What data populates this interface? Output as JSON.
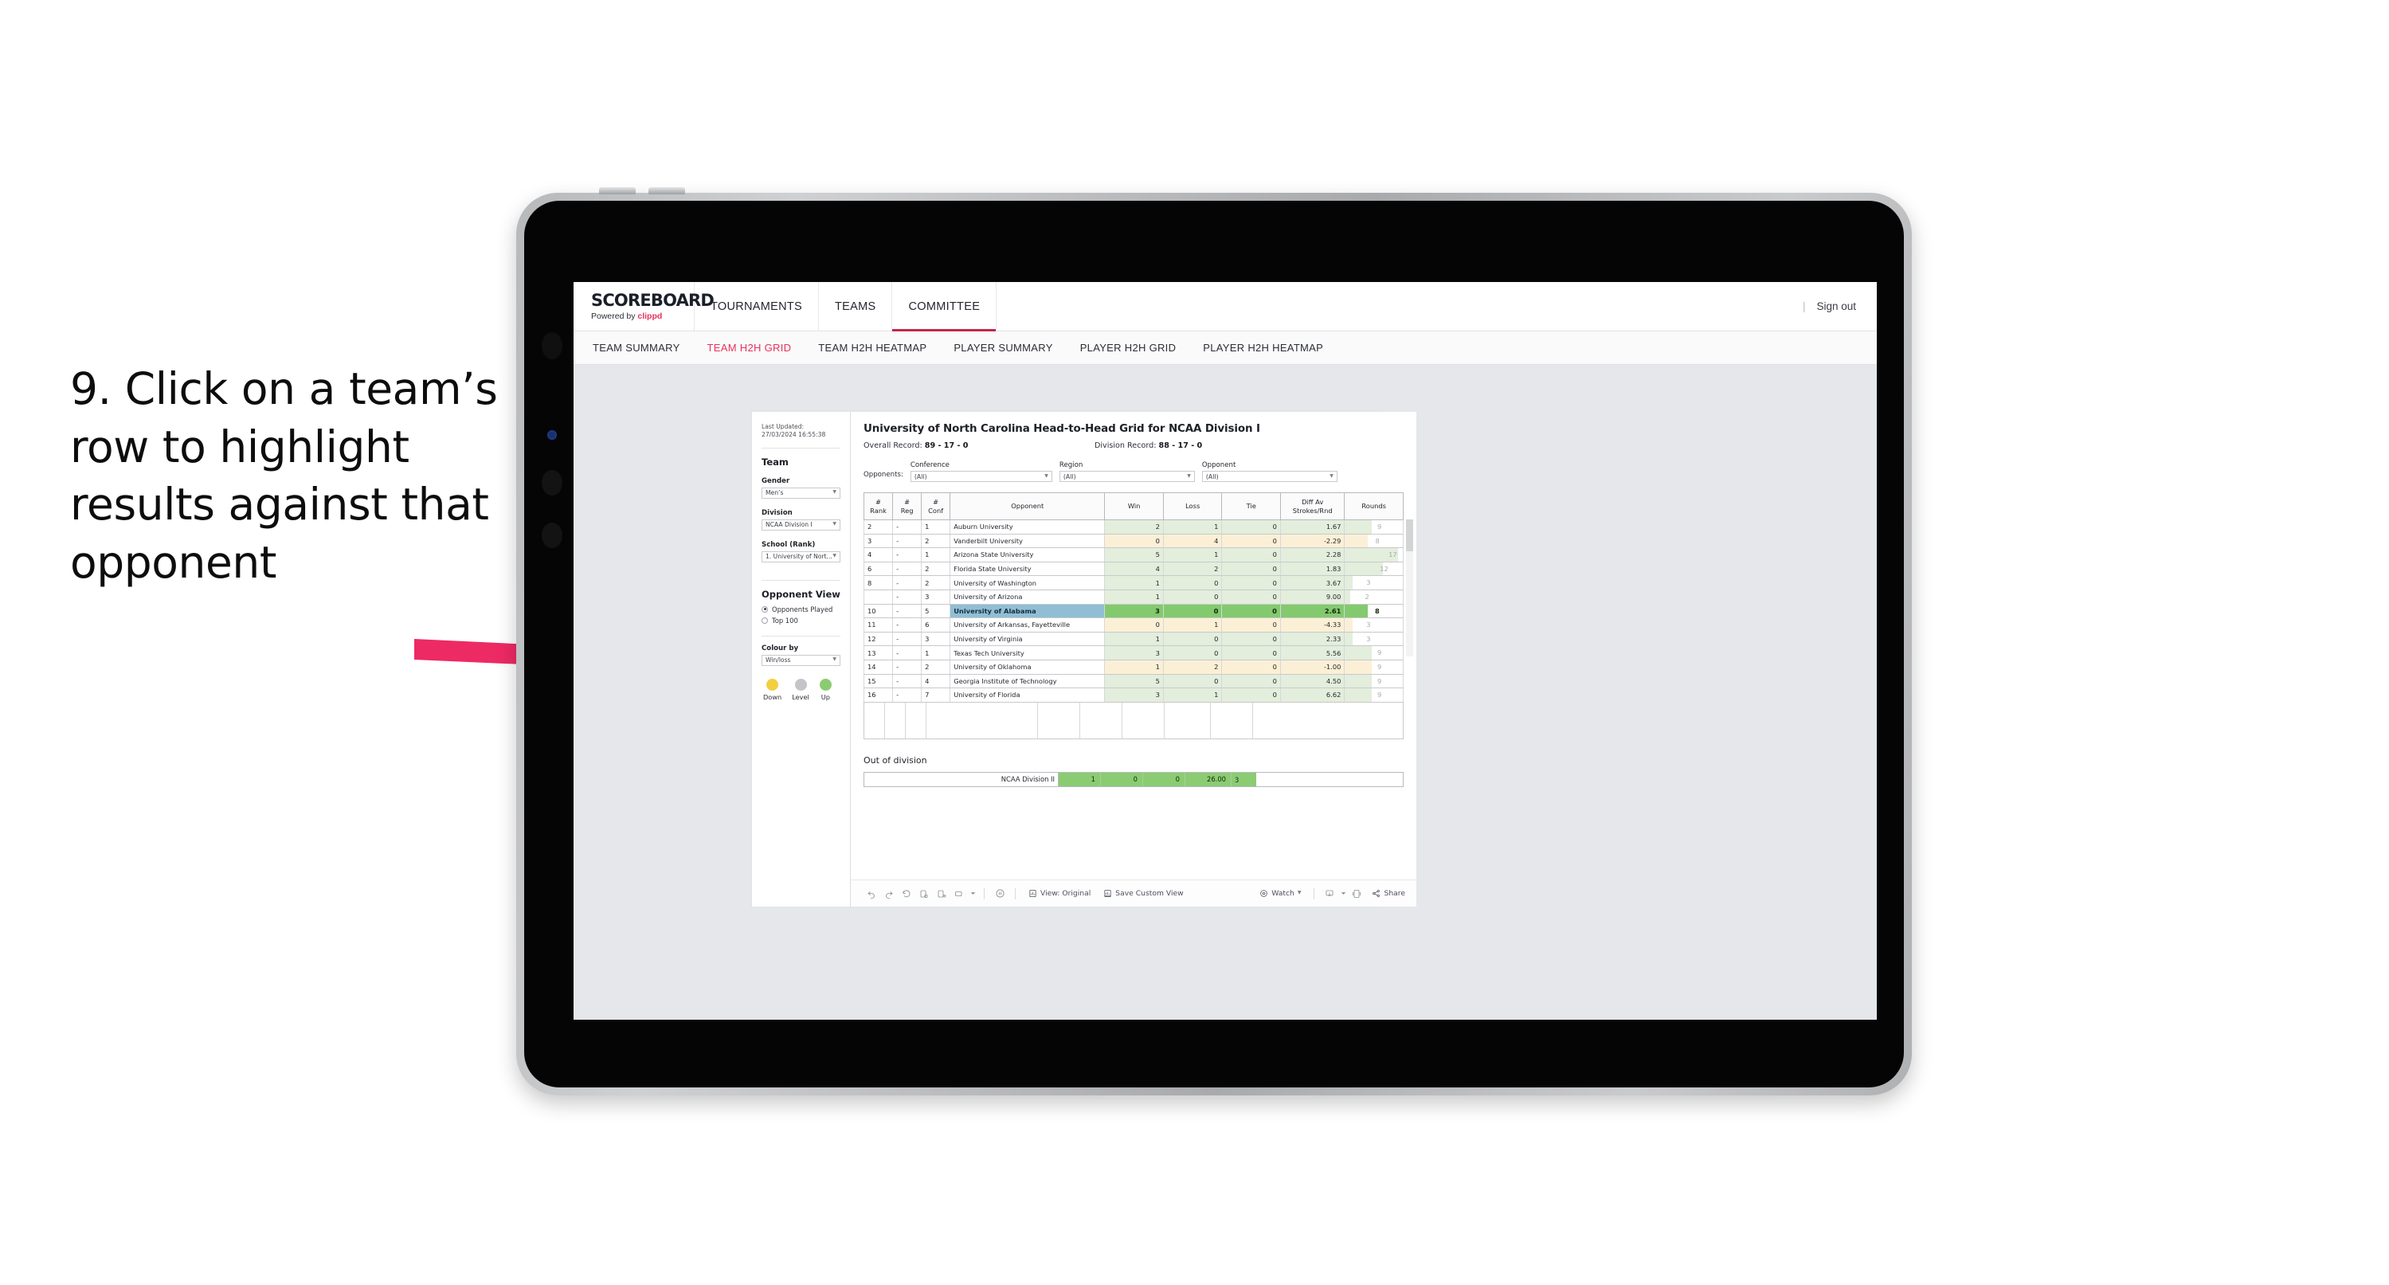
{
  "caption": "9. Click on a team’s row to highlight results against that opponent",
  "brand": {
    "title": "SCOREBOARD",
    "powered_prefix": "Powered by ",
    "powered_name": "clippd",
    "accent_color": "#e8315e"
  },
  "topnav": {
    "tabs": [
      {
        "label": "TOURNAMENTS",
        "active": false
      },
      {
        "label": "TEAMS",
        "active": false
      },
      {
        "label": "COMMITTEE",
        "active": true
      }
    ],
    "divider": "|",
    "signout": "Sign out",
    "active_underline_color": "#c4264b"
  },
  "subnav": {
    "items": [
      {
        "label": "TEAM SUMMARY",
        "active": false
      },
      {
        "label": "TEAM H2H GRID",
        "active": true
      },
      {
        "label": "TEAM H2H HEATMAP",
        "active": false
      },
      {
        "label": "PLAYER SUMMARY",
        "active": false
      },
      {
        "label": "PLAYER H2H GRID",
        "active": false
      },
      {
        "label": "PLAYER H2H HEATMAP",
        "active": false
      }
    ]
  },
  "filters": {
    "last_updated": "Last Updated: 27/03/2024 16:55:38",
    "team_title": "Team",
    "gender_label": "Gender",
    "gender_value": "Men’s",
    "division_label": "Division",
    "division_value": "NCAA Division I",
    "school_label": "School (Rank)",
    "school_value": "1. University of Nort...",
    "opponent_view_title": "Opponent View",
    "opponent_view_options": [
      {
        "label": "Opponents Played",
        "selected": true
      },
      {
        "label": "Top 100",
        "selected": false
      }
    ],
    "colour_by_label": "Colour by",
    "colour_by_value": "Win/loss",
    "legend": [
      {
        "caption": "Down",
        "color": "#f2cf3f"
      },
      {
        "caption": "Level",
        "color": "#c3c5c8"
      },
      {
        "caption": "Up",
        "color": "#8bcc72"
      }
    ]
  },
  "sheet": {
    "title": "University of North Carolina Head-to-Head Grid for NCAA Division I",
    "overall_record_label": "Overall Record:",
    "overall_record_value": "89 - 17 - 0",
    "division_record_label": "Division Record:",
    "division_record_value": "88 - 17 - 0",
    "opponents_label": "Opponents:",
    "filter_fields": [
      {
        "label": "Conference",
        "value": "(All)"
      },
      {
        "label": "Region",
        "value": "(All)"
      },
      {
        "label": "Opponent",
        "value": "(All)"
      }
    ],
    "out_of_division_title": "Out of division"
  },
  "chart_data": {
    "type": "table",
    "title": "University of North Carolina Head-to-Head Grid for NCAA Division I",
    "columns": [
      "# Rank",
      "# Reg",
      "# Conf",
      "Opponent",
      "Win",
      "Loss",
      "Tie",
      "Diff Av Strokes/Rnd",
      "Rounds"
    ],
    "column_headers_multiline": [
      [
        "#",
        "Rank"
      ],
      [
        "#",
        "Reg"
      ],
      [
        "#",
        "Conf"
      ],
      [
        "Opponent"
      ],
      [
        "Win"
      ],
      [
        "Loss"
      ],
      [
        "Tie"
      ],
      [
        "Diff Av",
        "Strokes/Rnd"
      ],
      [
        "Rounds"
      ]
    ],
    "rows": [
      {
        "rank": "2",
        "reg": "-",
        "conf": "1",
        "opponent": "Auburn University",
        "win": "2",
        "loss": "1",
        "tie": "0",
        "diff": "1.67",
        "rounds": "9",
        "rounds_pct": 46,
        "trend": "up",
        "selected": false
      },
      {
        "rank": "3",
        "reg": "-",
        "conf": "2",
        "opponent": "Vanderbilt University",
        "win": "0",
        "loss": "4",
        "tie": "0",
        "diff": "-2.29",
        "rounds": "8",
        "rounds_pct": 40,
        "trend": "down",
        "selected": false
      },
      {
        "rank": "4",
        "reg": "-",
        "conf": "1",
        "opponent": "Arizona State University",
        "win": "5",
        "loss": "1",
        "tie": "0",
        "diff": "2.28",
        "rounds": "17",
        "rounds_pct": 92,
        "trend": "up",
        "selected": false
      },
      {
        "rank": "6",
        "reg": "-",
        "conf": "2",
        "opponent": "Florida State University",
        "win": "4",
        "loss": "2",
        "tie": "0",
        "diff": "1.83",
        "rounds": "12",
        "rounds_pct": 66,
        "trend": "up",
        "selected": false
      },
      {
        "rank": "8",
        "reg": "-",
        "conf": "2",
        "opponent": "University of Washington",
        "win": "1",
        "loss": "0",
        "tie": "0",
        "diff": "3.67",
        "rounds": "3",
        "rounds_pct": 13,
        "trend": "up",
        "selected": false
      },
      {
        "rank": "",
        "reg": "-",
        "conf": "3",
        "opponent": "University of Arizona",
        "win": "1",
        "loss": "0",
        "tie": "0",
        "diff": "9.00",
        "rounds": "2",
        "rounds_pct": 9,
        "trend": "up",
        "selected": false
      },
      {
        "rank": "10",
        "reg": "-",
        "conf": "5",
        "opponent": "University of Alabama",
        "win": "3",
        "loss": "0",
        "tie": "0",
        "diff": "2.61",
        "rounds": "8",
        "rounds_pct": 40,
        "trend": "up",
        "selected": true
      },
      {
        "rank": "11",
        "reg": "-",
        "conf": "6",
        "opponent": "University of Arkansas, Fayetteville",
        "win": "0",
        "loss": "1",
        "tie": "0",
        "diff": "-4.33",
        "rounds": "3",
        "rounds_pct": 13,
        "trend": "down",
        "selected": false
      },
      {
        "rank": "12",
        "reg": "-",
        "conf": "3",
        "opponent": "University of Virginia",
        "win": "1",
        "loss": "0",
        "tie": "0",
        "diff": "2.33",
        "rounds": "3",
        "rounds_pct": 13,
        "trend": "up",
        "selected": false
      },
      {
        "rank": "13",
        "reg": "-",
        "conf": "1",
        "opponent": "Texas Tech University",
        "win": "3",
        "loss": "0",
        "tie": "0",
        "diff": "5.56",
        "rounds": "9",
        "rounds_pct": 46,
        "trend": "up",
        "selected": false
      },
      {
        "rank": "14",
        "reg": "-",
        "conf": "2",
        "opponent": "University of Oklahoma",
        "win": "1",
        "loss": "2",
        "tie": "0",
        "diff": "-1.00",
        "rounds": "9",
        "rounds_pct": 46,
        "trend": "down",
        "selected": false
      },
      {
        "rank": "15",
        "reg": "-",
        "conf": "4",
        "opponent": "Georgia Institute of Technology",
        "win": "5",
        "loss": "0",
        "tie": "0",
        "diff": "4.50",
        "rounds": "9",
        "rounds_pct": 46,
        "trend": "up",
        "selected": false
      },
      {
        "rank": "16",
        "reg": "-",
        "conf": "7",
        "opponent": "University of Florida",
        "win": "3",
        "loss": "1",
        "tie": "0",
        "diff": "6.62",
        "rounds": "9",
        "rounds_pct": 46,
        "trend": "up",
        "selected": false
      }
    ],
    "out_of_division": {
      "name": "NCAA Division II",
      "win": "1",
      "loss": "0",
      "tie": "0",
      "diff": "26.00",
      "rounds": "3"
    }
  },
  "toolbar": {
    "view_label": "View: Original",
    "save_label": "Save Custom View",
    "watch_label": "Watch",
    "share_label": "Share"
  }
}
